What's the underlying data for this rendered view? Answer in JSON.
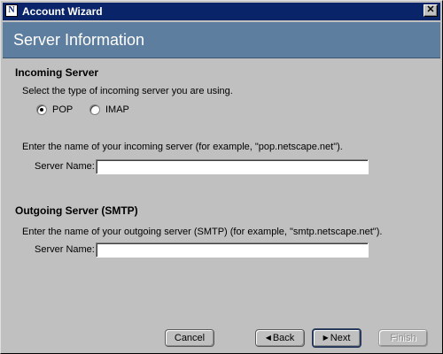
{
  "window": {
    "title": "Account Wizard",
    "app_icon_glyph": "N",
    "close_glyph": "✕"
  },
  "header": {
    "title": "Server Information"
  },
  "incoming": {
    "heading": "Incoming Server",
    "instruction": "Select the type of incoming server you are using.",
    "options": [
      {
        "label": "POP",
        "selected": true
      },
      {
        "label": "IMAP",
        "selected": false
      }
    ],
    "hint": "Enter the name of your incoming server  (for example, \"pop.netscape.net\").",
    "field_label": "Server Name:",
    "field_value": ""
  },
  "outgoing": {
    "heading": "Outgoing Server (SMTP)",
    "hint": "Enter the name of your outgoing server (SMTP)  (for example, \"smtp.netscape.net\").",
    "field_label": "Server Name:",
    "field_value": ""
  },
  "buttons": {
    "cancel": "Cancel",
    "back": "Back",
    "next": "Next",
    "finish": "Finish",
    "back_glyph": "◀",
    "next_glyph": "▶"
  }
}
